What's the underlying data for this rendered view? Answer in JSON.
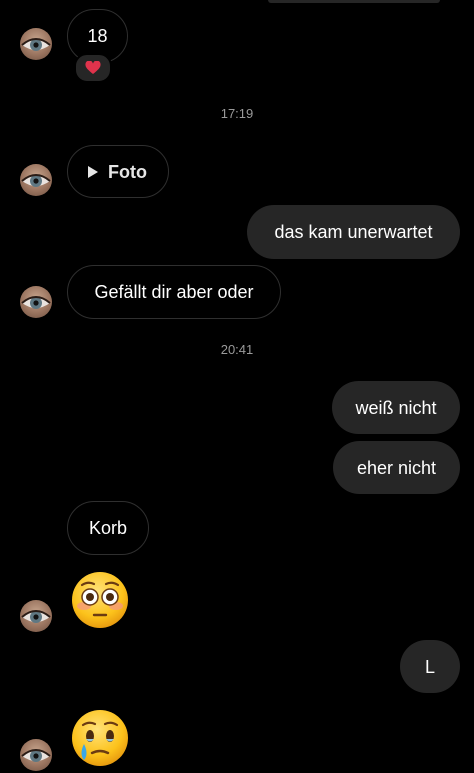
{
  "messages": {
    "m1": "18",
    "m1_reaction": "❤️",
    "time1": "17:19",
    "m2_media": "Foto",
    "m3": "das kam unerwartet",
    "m4": "Gefällt dir aber oder",
    "time2": "20:41",
    "m5": "weiß nicht",
    "m6": "eher nicht",
    "m7": "Korb",
    "m8_emoji": "flushed-face",
    "m9": "L",
    "m10_emoji": "face-holding-back-tears"
  },
  "colors": {
    "background": "#000000",
    "outgoing_bubble": "#262626",
    "incoming_border": "#2f2f2f",
    "timestamp": "#9a9a9a",
    "reaction_heart": "#e0334c"
  }
}
